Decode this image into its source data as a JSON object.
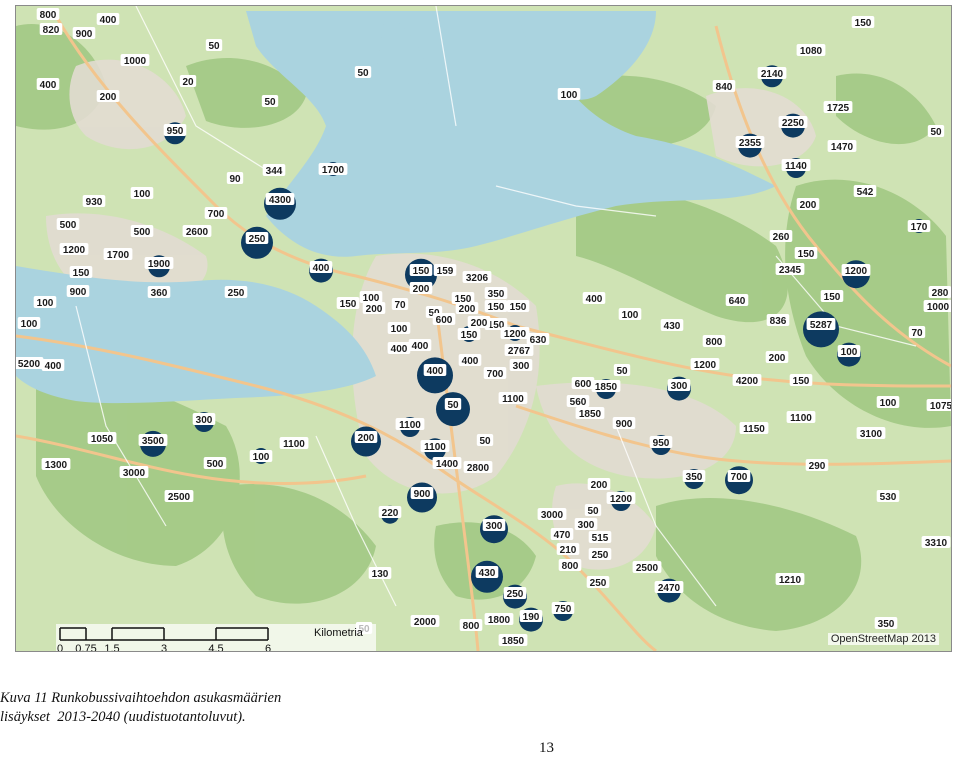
{
  "colors": {
    "water": "#aad3df",
    "land": "#cfe3b4",
    "forest": "#9fc781",
    "urban": "#e2dcd2",
    "marker": "#0d3a60",
    "road": "#f2c58d"
  },
  "credit": "OpenStreetMap 2013",
  "scale_bar": {
    "unit": "Kilometria",
    "ticks": [
      "0",
      "0,75",
      "1,5",
      "3",
      "4,5",
      "6"
    ]
  },
  "caption": {
    "line1": "Kuva 11 Runkobussivaihtoehdon asukasmäärien",
    "line2_a": "lisäykset",
    "line2_b": "2013-2040 (uudistuotantoluvut)."
  },
  "page_number": "13",
  "labels": [
    "800",
    "820",
    "900",
    "400",
    "1000",
    "400",
    "200",
    "20",
    "50",
    "50",
    "50",
    "150",
    "1080",
    "2140",
    "840",
    "100",
    "1725",
    "2250",
    "2355",
    "1470",
    "50",
    "950",
    "344",
    "1700",
    "90",
    "930",
    "100",
    "700",
    "4300",
    "1140",
    "542",
    "200",
    "500",
    "500",
    "2600",
    "250",
    "150",
    "170",
    "260",
    "1200",
    "1700",
    "1900",
    "400",
    "150",
    "159",
    "3206",
    "1200",
    "150",
    "900",
    "360",
    "250",
    "200",
    "70",
    "2345",
    "150",
    "350",
    "280",
    "100",
    "150",
    "200",
    "150",
    "150",
    "150",
    "400",
    "640",
    "1000",
    "100",
    "50",
    "100",
    "200",
    "150",
    "100",
    "430",
    "836",
    "5287",
    "70",
    "100",
    "600",
    "150",
    "200",
    "1200",
    "630",
    "800",
    "400",
    "400",
    "2767",
    "100",
    "5200",
    "400",
    "400",
    "400",
    "700",
    "300",
    "50",
    "1200",
    "200",
    "600",
    "1850",
    "4200",
    "150",
    "300",
    "50",
    "1100",
    "560",
    "1850",
    "1075",
    "100",
    "300",
    "1100",
    "900",
    "1150",
    "1100",
    "3100",
    "1050",
    "3500",
    "1100",
    "200",
    "1100",
    "50",
    "950",
    "1300",
    "500",
    "100",
    "1400",
    "2800",
    "350",
    "700",
    "290",
    "3000",
    "2500",
    "900",
    "200",
    "1200",
    "530",
    "220",
    "3000",
    "50",
    "300",
    "300",
    "470",
    "515",
    "210",
    "250",
    "800",
    "3310",
    "130",
    "430",
    "2500",
    "250",
    "2470",
    "1210",
    "250",
    "750",
    "2000",
    "1800",
    "190",
    "50",
    "800",
    "350",
    "1850"
  ]
}
